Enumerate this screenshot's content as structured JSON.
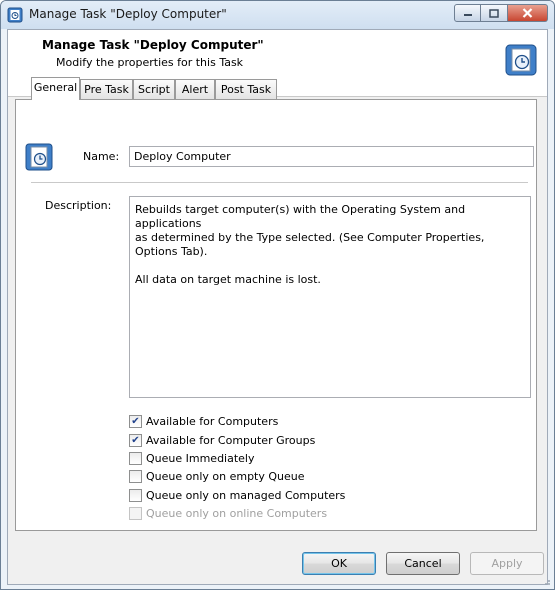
{
  "window": {
    "title": "Manage Task \"Deploy Computer\""
  },
  "header": {
    "title": "Manage Task \"Deploy Computer\"",
    "subtitle": "Modify the properties for this Task"
  },
  "tabs": [
    {
      "label": "General",
      "active": true
    },
    {
      "label": "Pre Task",
      "active": false
    },
    {
      "label": "Script",
      "active": false
    },
    {
      "label": "Alert",
      "active": false
    },
    {
      "label": "Post Task",
      "active": false
    }
  ],
  "general": {
    "name_label": "Name:",
    "name_value": "Deploy Computer",
    "description_label": "Description:",
    "description_line1": "Rebuilds target computer(s) with the Operating System and applications",
    "description_line2": "as determined by the Type selected. (See Computer Properties, Options Tab).",
    "description_line3": "All data on target machine is lost."
  },
  "options": [
    {
      "label": "Available for Computers",
      "checked": true,
      "enabled": true
    },
    {
      "label": "Available for Computer Groups",
      "checked": true,
      "enabled": true
    },
    {
      "label": "Queue Immediately",
      "checked": false,
      "enabled": true
    },
    {
      "label": "Queue only on empty Queue",
      "checked": false,
      "enabled": true
    },
    {
      "label": "Queue only on managed Computers",
      "checked": false,
      "enabled": true
    },
    {
      "label": "Queue only on online Computers",
      "checked": false,
      "enabled": false
    }
  ],
  "buttons": {
    "ok": "OK",
    "cancel": "Cancel",
    "apply": "Apply"
  },
  "icons": {
    "title": "task-icon",
    "header": "task-clock-icon",
    "name": "task-clock-icon"
  },
  "colors": {
    "accent": "#2e6db4",
    "checkmark": "#21428c",
    "disabled_text": "#a0a0a0"
  }
}
